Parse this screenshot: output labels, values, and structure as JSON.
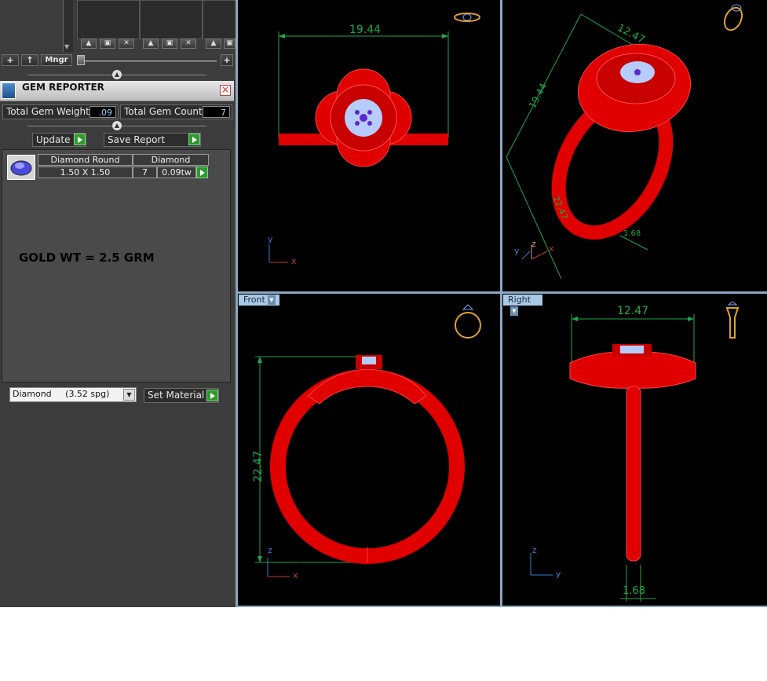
{
  "toolbar": {
    "add_label": "+",
    "up_label": "↑",
    "mngr_label": "Mngr",
    "right_add_label": "+"
  },
  "gem_reporter": {
    "title": "GEM REPORTER",
    "close_label": "×",
    "total_weight_label": "Total Gem Weight",
    "total_weight_value": ".09",
    "total_count_label": "Total Gem Count",
    "total_count_value": "7",
    "update_label": "Update",
    "save_report_label": "Save Report",
    "table": {
      "col1_header": "Diamond Round",
      "col2_header": "Diamond",
      "size": "1.50 X 1.50",
      "count": "7",
      "weight": "0.09tw"
    },
    "note": "GOLD WT = 2.5 GRM",
    "material_select": "Diamond     (3.52 spg)",
    "set_material_label": "Set Material"
  },
  "viewports": {
    "top": {
      "dimension": "19.44",
      "axis_y": "y",
      "axis_x": "x"
    },
    "perspective": {
      "dim_a": "12.47",
      "dim_b": "19.44",
      "dim_c": "22.47",
      "dim_d": "1.68",
      "axis_y": "y",
      "axis_z": "z",
      "axis_x": "x"
    },
    "front": {
      "label": "Front",
      "dimension": "22.47",
      "axis_z": "z",
      "axis_x": "x"
    },
    "right": {
      "label": "Right",
      "dim_top": "12.47",
      "dim_bottom": "1.68",
      "axis_z": "z",
      "axis_y": "y"
    }
  },
  "colors": {
    "ring": "#e00000",
    "gem": "#a8c4ff",
    "dimension": "#1fa84a",
    "axis_red": "#c0392b",
    "axis_blue": "#3a7bd5",
    "viewport_label": "#a9c9e6"
  }
}
